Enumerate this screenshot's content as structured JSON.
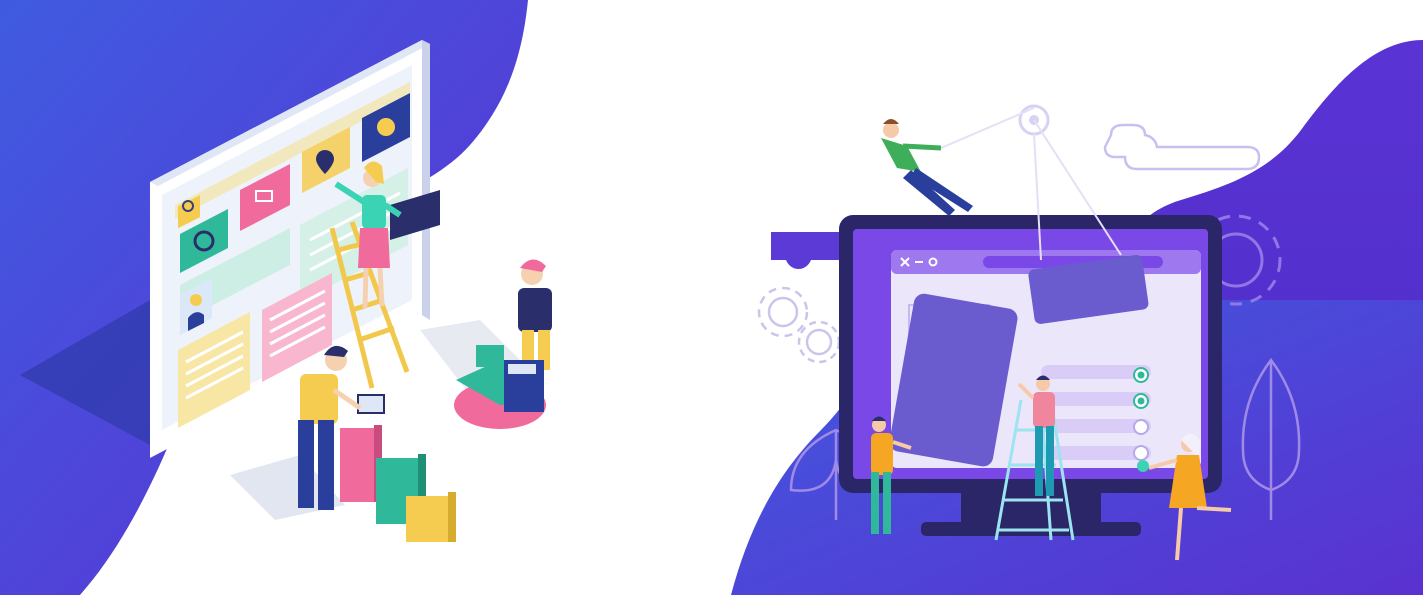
{
  "panels": [
    {
      "id": "left",
      "icons": [
        "search-icon",
        "cart-icon",
        "location-pin-icon",
        "chat-icon",
        "gear-icon",
        "user-avatar-icon"
      ]
    },
    {
      "id": "right",
      "browser_controls": [
        "close-icon",
        "minimize-icon",
        "maximize-icon"
      ]
    }
  ],
  "colors": {
    "brand_purple": "#5b2fd0",
    "deep_blue": "#3d4fd9",
    "navy": "#2a2f6b",
    "screen_violet": "#7b48e8",
    "mint": "#2fb99a",
    "pink": "#f06a9c",
    "yellow": "#f5cc4f"
  }
}
